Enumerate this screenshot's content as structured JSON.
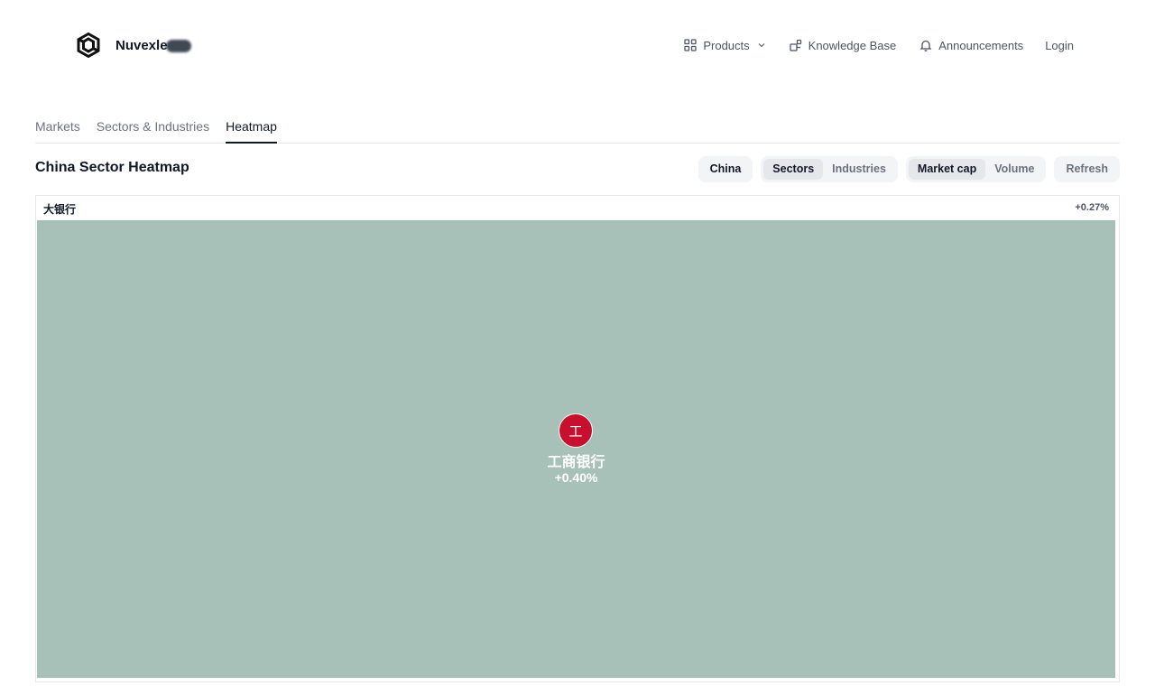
{
  "brand": {
    "name": "Nuvexle",
    "logo_icon": "hexagon-logo-icon"
  },
  "nav": {
    "products_label": "Products",
    "knowledge_base_label": "Knowledge Base",
    "announcements_label": "Announcements",
    "login_label": "Login"
  },
  "tabs": [
    {
      "label": "Markets",
      "active": false
    },
    {
      "label": "Sectors & Industries",
      "active": false
    },
    {
      "label": "Heatmap",
      "active": true
    }
  ],
  "section": {
    "title": "China Sector Heatmap"
  },
  "controls": {
    "region": "China",
    "grouping": {
      "sectors": "Sectors",
      "industries": "Industries",
      "selected": "Sectors"
    },
    "metric": {
      "market_cap": "Market cap",
      "volume": "Volume",
      "selected": "Market cap"
    },
    "refresh": "Refresh"
  },
  "heatmap": {
    "sector_name": "大银行",
    "sector_change": "+0.27%",
    "tiles": [
      {
        "logo_char": "工",
        "name": "工商银行",
        "change": "+0.40%",
        "color": "#a7c1b9",
        "logo_color": "#c8102e"
      }
    ]
  }
}
